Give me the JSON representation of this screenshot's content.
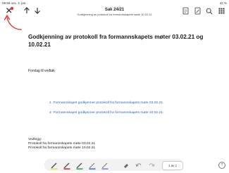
{
  "statusbar": {
    "time": "09:55",
    "date": "ons. 4. jan.",
    "battery": "42 %"
  },
  "header": {
    "title": "Sak 24/21",
    "subtitle": "Godkjenning av protokoll fra formannskapets møte 10.02.21"
  },
  "icons": {
    "close": "close-icon",
    "up": "arrow-up-icon",
    "down": "arrow-down-icon",
    "right": [
      "document-icon",
      "annotate-icon",
      "search-icon",
      "grid-icon"
    ]
  },
  "document": {
    "heading": "Godkjenning av protokoll fra formannskapets møter 03.02.21 og 10.02.21",
    "intro": "Forslag til vedtak",
    "list": [
      "1.  Formannskapet godkjenner protokoll fra formannskapets møte 03.02.21.",
      "2.  Formannskapet godkjenner protokoll fra formannskapets møte 10.02.21."
    ],
    "attachments_label": "Vedlegg:",
    "attachments": [
      "Protokoll fra formannskapets møte 03.02.21",
      "Protokoll fra formannskapets møte 10.02.21"
    ]
  },
  "toolbar": {
    "tools": [
      {
        "name": "highlighter-yellow",
        "color": "#f2e03a"
      },
      {
        "name": "pen-red",
        "color": "#d93030"
      },
      {
        "name": "pen-green",
        "color": "#2da84a"
      },
      {
        "name": "pen-blue",
        "color": "#3a78d8"
      },
      {
        "name": "pen-purple",
        "color": "#a274d6"
      }
    ],
    "page_indicator": "1 av 1"
  },
  "help": "?",
  "colors": {
    "accent_red": "#e0362b",
    "link_blue": "#2a62c9"
  }
}
